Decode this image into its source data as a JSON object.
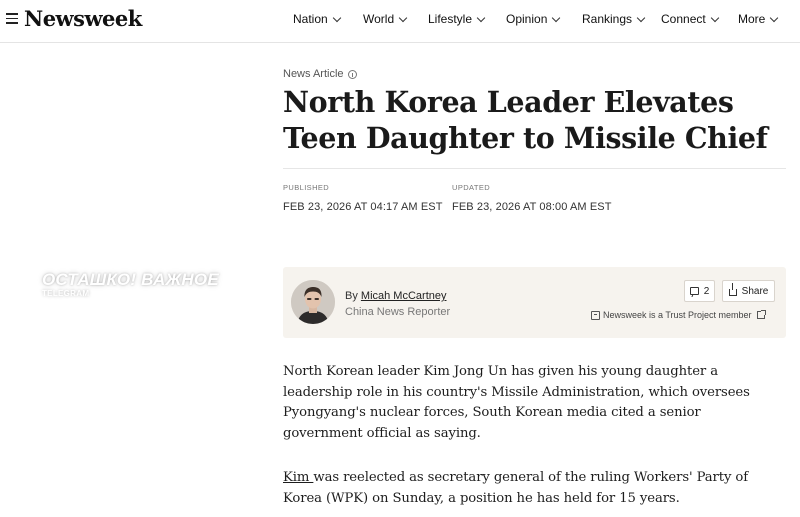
{
  "header": {
    "logo": "Newsweek",
    "nav": [
      {
        "label": "Nation"
      },
      {
        "label": "World"
      },
      {
        "label": "Lifestyle"
      },
      {
        "label": "Opinion"
      },
      {
        "label": "Rankings"
      },
      {
        "label": "Connect"
      },
      {
        "label": "More"
      }
    ]
  },
  "watermark": {
    "main": "ОСТАШКО! ВАЖНОЕ",
    "sub": "TELEGRAM"
  },
  "article": {
    "kicker": "News Article",
    "headline": "North Korea Leader Elevates Teen Daughter to Missile Chief",
    "published_label": "PUBLISHED",
    "published_value": "FEB 23, 2026 AT 04:17 AM EST",
    "updated_label": "UPDATED",
    "updated_value": "FEB 23, 2026 AT 08:00 AM EST"
  },
  "author": {
    "by": "By",
    "name": "Micah McCartney",
    "role": "China News Reporter",
    "comments_count": "2",
    "share_label": "Share",
    "trust_text": "Newsweek is a Trust Project member"
  },
  "body": {
    "p1": "North Korean leader Kim Jong Un has given his young daughter a leadership role in his country's Missile Administration, which oversees Pyongyang's nuclear forces, South Korean media cited a senior government official as saying.",
    "p2_link": "Kim ",
    "p2_rest": "was reelected as secretary general of the ruling Workers' Party of Korea (WPK) on Sunday, a position he has held for 15 years."
  }
}
